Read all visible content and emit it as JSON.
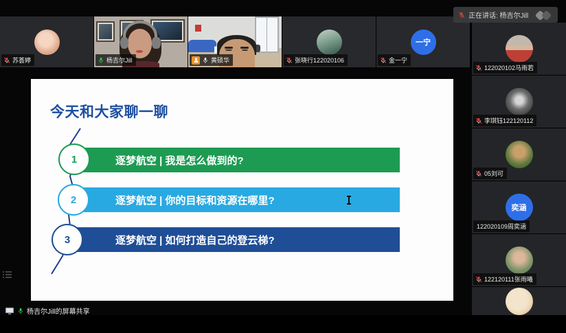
{
  "speaking_banner": {
    "label": "正在讲话: 杨吉尔Jill"
  },
  "top_tiles": [
    {
      "name": "苏荟婷",
      "mic": "muted",
      "type": "avatar-photo"
    },
    {
      "name": "杨吉尔Jill",
      "mic": "on",
      "type": "video",
      "active_speaker": true
    },
    {
      "name": "黄硕华",
      "mic": "on",
      "type": "video",
      "host_badge": true
    },
    {
      "name": "张晓行122020106",
      "mic": "muted",
      "type": "avatar-photo"
    },
    {
      "name": "金一宁",
      "mic": "muted",
      "type": "avatar-initials",
      "avatar_text": "一宁"
    }
  ],
  "sidebar_tiles": [
    {
      "name": "122020102马雨若",
      "mic": "muted",
      "type": "avatar-photo"
    },
    {
      "name": "李琪钰122120112",
      "mic": "muted",
      "type": "avatar-photo"
    },
    {
      "name": "05刘可",
      "mic": "muted",
      "type": "avatar-photo"
    },
    {
      "name": "122020109周奕涵",
      "mic": "none",
      "type": "avatar-initials",
      "avatar_text": "奕涵"
    },
    {
      "name": "122120111张雨曦",
      "mic": "muted",
      "type": "avatar-photo"
    },
    {
      "name": "",
      "mic": "none",
      "type": "avatar-photo"
    }
  ],
  "slide": {
    "title": "今天和大家聊一聊",
    "items": [
      {
        "num": "1",
        "text": "逐梦航空 | 我是怎么做到的?",
        "color": "#1d9b53"
      },
      {
        "num": "2",
        "text": "逐梦航空 | 你的目标和资源在哪里?",
        "color": "#29a9e1"
      },
      {
        "num": "3",
        "text": "逐梦航空 | 如何打造自己的登云梯?",
        "color": "#1f4e97"
      }
    ]
  },
  "share_banner": {
    "label": "杨吉尔Jill的屏幕共享"
  },
  "colors": {
    "slide_title_blue": "#1c4fa1",
    "bar_green": "#1d9b53",
    "bar_light_blue": "#29a9e1",
    "bar_dark_blue": "#1f4e97",
    "connector_blue": "#1e3f8c",
    "active_speaker_border": "#35cf5b",
    "muted_mic_red": "#d9413d",
    "live_mic_green": "#35c553",
    "host_badge_orange": "#e8912d",
    "initials_avatar_blue": "#2e6fe8"
  }
}
